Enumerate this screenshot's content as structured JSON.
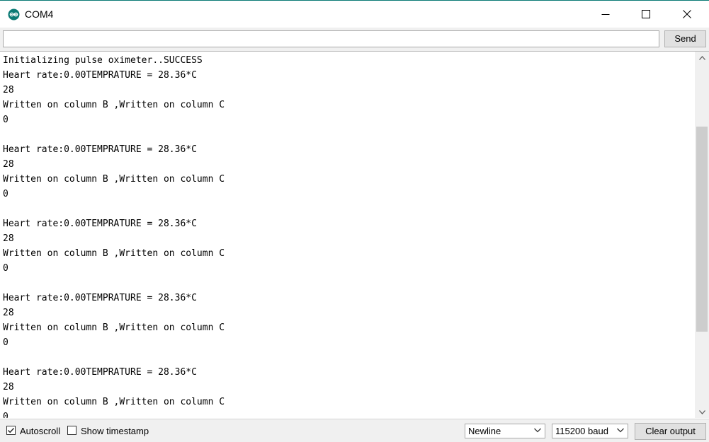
{
  "window": {
    "title": "COM4",
    "icon": "arduino-icon",
    "controls": [
      "minimize-icon",
      "maximize-icon",
      "close-icon"
    ]
  },
  "send_bar": {
    "input_value": "",
    "input_placeholder": "",
    "send_label": "Send"
  },
  "output": {
    "lines": [
      "Initializing pulse oximeter..SUCCESS",
      "Heart rate:0.00TEMPRATURE = 28.36*C",
      "28",
      "Written on column B ,Written on column C",
      "0",
      "",
      "Heart rate:0.00TEMPRATURE = 28.36*C",
      "28",
      "Written on column B ,Written on column C",
      "0",
      "",
      "Heart rate:0.00TEMPRATURE = 28.36*C",
      "28",
      "Written on column B ,Written on column C",
      "0",
      "",
      "Heart rate:0.00TEMPRATURE = 28.36*C",
      "28",
      "Written on column B ,Written on column C",
      "0",
      "",
      "Heart rate:0.00TEMPRATURE = 28.36*C",
      "28",
      "Written on column B ,Written on column C",
      "0"
    ]
  },
  "footer": {
    "autoscroll": {
      "label": "Autoscroll",
      "checked": true
    },
    "timestamp": {
      "label": "Show timestamp",
      "checked": false
    },
    "line_ending": {
      "selected": "Newline"
    },
    "baud_rate": {
      "selected": "115200 baud"
    },
    "clear_label": "Clear output"
  },
  "colors": {
    "accent": "#0b7a75",
    "panel": "#f0f0f0",
    "button": "#e1e1e1"
  }
}
